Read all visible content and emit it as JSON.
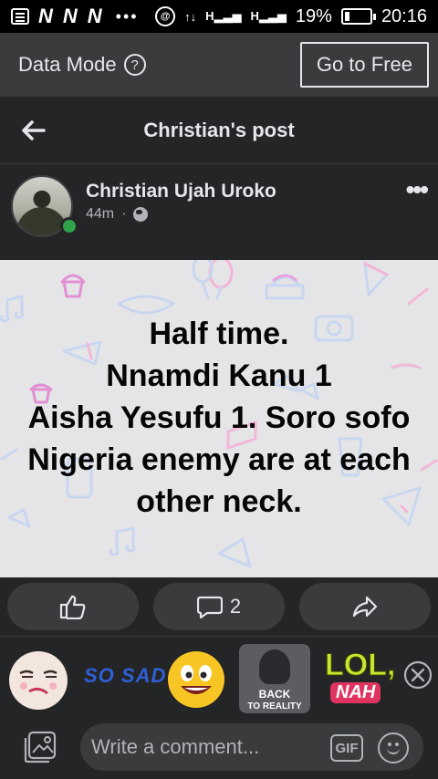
{
  "status_bar": {
    "carrier_letters": [
      "N",
      "N",
      "N"
    ],
    "overflow": "•••",
    "network_1": "H",
    "network_2": "H",
    "battery": "19%",
    "battery_level": 0.19,
    "time": "20:16",
    "icons": [
      "notes-icon",
      "carrier-n-icon",
      "dots-icon",
      "data-saver-icon",
      "data-arrows-icon",
      "signal-icon",
      "battery-icon"
    ]
  },
  "data_mode": {
    "label": "Data Mode",
    "help_icon": "?",
    "button": "Go to Free"
  },
  "header": {
    "title": "Christian's post",
    "back_icon": "back-arrow-icon"
  },
  "post": {
    "author": "Christian Ujah Uroko",
    "time": "44m",
    "separator": "·",
    "privacy_icon": "globe-icon",
    "more_icon": "•••",
    "text_lines": [
      "Half time.",
      "Nnamdi Kanu 1",
      "Aisha Yesufu 1. Soro sofo",
      "Nigeria enemy are at each",
      "other neck."
    ],
    "background_color": "#e5e5e7"
  },
  "actions": {
    "like_icon": "thumbs-up-icon",
    "comment_icon": "comment-icon",
    "comment_count": "2",
    "share_icon": "share-icon"
  },
  "stickers": {
    "items": [
      {
        "name": "sticker-meh-face",
        "text": ""
      },
      {
        "name": "sticker-so-sad",
        "text": "SO SAD"
      },
      {
        "name": "sticker-emoji-grin",
        "text": ""
      },
      {
        "name": "sticker-back-to-reality",
        "text_top": "BACK",
        "text_bottom": "TO REALITY"
      },
      {
        "name": "sticker-lol-nah",
        "text_top": "LOL,",
        "text_bottom": "NAH"
      }
    ],
    "close_icon": "close-icon"
  },
  "comment_bar": {
    "placeholder": "Write a comment...",
    "gif_label": "GIF",
    "photo_icon": "photo-icon",
    "emoji_icon": "emoji-icon"
  },
  "colors": {
    "background": "#18191a",
    "surface": "#242526",
    "surface_alt": "#3a3b3c",
    "text": "#e4e6eb",
    "muted": "#b0b3b8",
    "online": "#31a24c",
    "post_bg": "#e5e5e7"
  }
}
